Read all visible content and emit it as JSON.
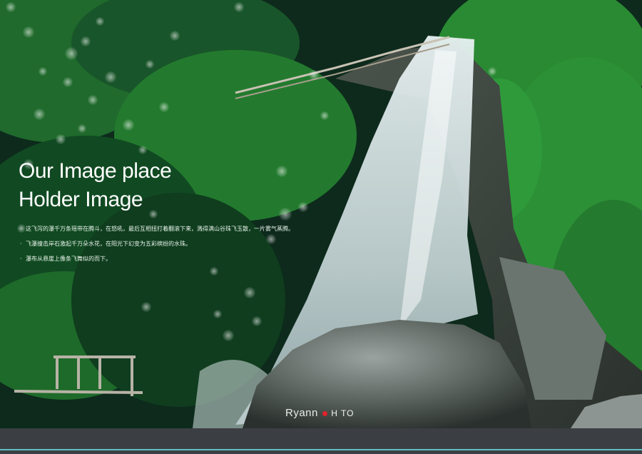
{
  "headline": {
    "line1": "Our Image place",
    "line2": "Holder Image"
  },
  "description": [
    "这飞泻的瀑千万条瑶带在腾斗，在怒吼，最后互相扭打着翻滚下来，溅得满山谷珠飞玉散，一片雾气蒸腾。",
    "飞瀑撞击岸石激起千万朵水花，在阳光下幻变为五彩缤纷的水珠。",
    "瀑布从悬崖上像条飞舞似的而下。"
  ],
  "brand": {
    "name": "Ryann",
    "suffix": "H  TO"
  },
  "colors": {
    "footer": "#3b3e42",
    "accent_line": "#5fbec0",
    "brand_dot": "#e0222a"
  }
}
